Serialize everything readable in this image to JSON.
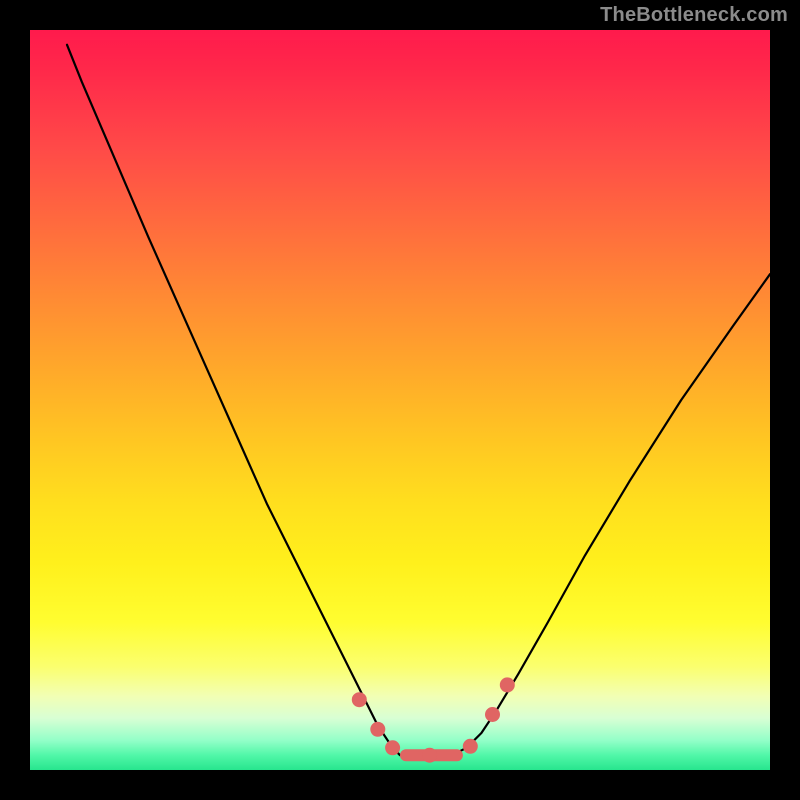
{
  "watermark": "TheBottleneck.com",
  "chart_data": {
    "type": "line",
    "title": "",
    "xlabel": "",
    "ylabel": "",
    "xlim": [
      0,
      100
    ],
    "ylim": [
      0,
      100
    ],
    "grid": false,
    "legend": false,
    "series": [
      {
        "name": "curve",
        "x": [
          5,
          7,
          10,
          13,
          16,
          20,
          24,
          28,
          32,
          36,
          40,
          43,
          45,
          47,
          49,
          50,
          51,
          53,
          55,
          57,
          59,
          61,
          63,
          66,
          70,
          75,
          81,
          88,
          95,
          100
        ],
        "y": [
          98,
          93,
          86,
          79,
          72,
          63,
          54,
          45,
          36,
          28,
          20,
          14,
          10,
          6,
          3,
          2,
          2,
          2,
          2,
          2,
          3,
          5,
          8,
          13,
          20,
          29,
          39,
          50,
          60,
          67
        ]
      },
      {
        "name": "markers",
        "points": [
          {
            "x": 44.5,
            "y": 9.5
          },
          {
            "x": 47.0,
            "y": 5.5
          },
          {
            "x": 49.0,
            "y": 3.0
          },
          {
            "x": 54.0,
            "y": 2.0
          },
          {
            "x": 59.5,
            "y": 3.2
          },
          {
            "x": 62.5,
            "y": 7.5
          },
          {
            "x": 64.5,
            "y": 11.5
          }
        ],
        "bar_segment": {
          "x0": 50.0,
          "x1": 58.5,
          "y": 2.0
        }
      }
    ],
    "colors": {
      "curve": "#000000",
      "markers": "#e06563"
    }
  }
}
